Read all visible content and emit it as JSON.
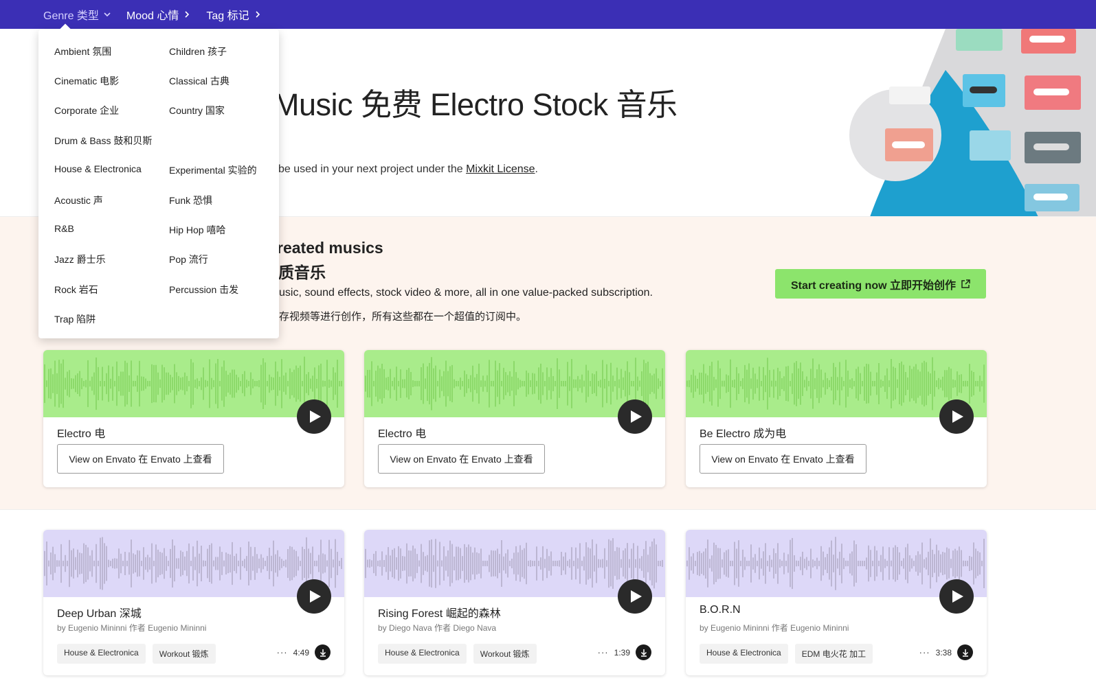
{
  "nav": {
    "genre": "Genre  类型",
    "mood": "Mood  心情",
    "tag": "Tag  标记"
  },
  "genre_menu": {
    "left": [
      "Ambient  氛围",
      "Cinematic  电影",
      "Corporate  企业",
      "Drum & Bass  鼓和贝斯",
      "House & Electronica",
      "Acoustic  声",
      "R&B",
      "Jazz  爵士乐",
      "Rock  岩石",
      "Trap  陷阱"
    ],
    "right": [
      "Children  孩子",
      "Classical  古典",
      "Country  国家",
      "Experimental  实验的",
      "Funk  恐惧",
      "Hip Hop  嘻哈",
      "Pop  流行",
      "Percussion  击发"
    ]
  },
  "hero": {
    "title": "Music 免费 Electro Stock 音乐",
    "subtitle_prefix": "be used in your next project under the ",
    "license_link": "Mixkit License",
    "subtitle_suffix": "."
  },
  "promo": {
    "heading_line1": "reated musics",
    "heading_line2": "质音乐",
    "text_en": "usic, sound effects, stock video & more, all in one value-packed subscription.",
    "text_zh": "存视频等进行创作，所有这些都在一个超值的订阅中。",
    "cta_label": "Start creating now 立即开始创作"
  },
  "envato_cards": [
    {
      "title": "Electro  电",
      "button": "View on Envato 在 Envato 上查看"
    },
    {
      "title": "Electro  电",
      "button": "View on Envato 在 Envato 上查看"
    },
    {
      "title": "Be Electro  成为电",
      "button": "View on Envato 在 Envato 上查看"
    }
  ],
  "track_cards": [
    {
      "title": "Deep Urban  深城",
      "author": "by Eugenio Mininni  作者 Eugenio Mininni",
      "tags": [
        "House & Electronica",
        "Workout 锻炼"
      ],
      "more": "···",
      "duration": "4:49"
    },
    {
      "title": "Rising Forest  崛起的森林",
      "author": "by Diego Nava  作者 Diego Nava",
      "tags": [
        "House & Electronica",
        "Workout 锻炼"
      ],
      "more": "···",
      "duration": "1:39"
    },
    {
      "title": "B.O.R.N",
      "author": "by Eugenio Mininni  作者 Eugenio Mininni",
      "tags": [
        "House & Electronica",
        "EDM 电火花 加工"
      ],
      "more": "···",
      "duration": "3:38"
    }
  ],
  "colors": {
    "nav_bg": "#3b2fb5",
    "green_wave": "#a9ec8b",
    "purple_wave": "#ddd8f8",
    "cta_bg": "#8ce46c",
    "promo_bg": "#fdf4ee"
  }
}
